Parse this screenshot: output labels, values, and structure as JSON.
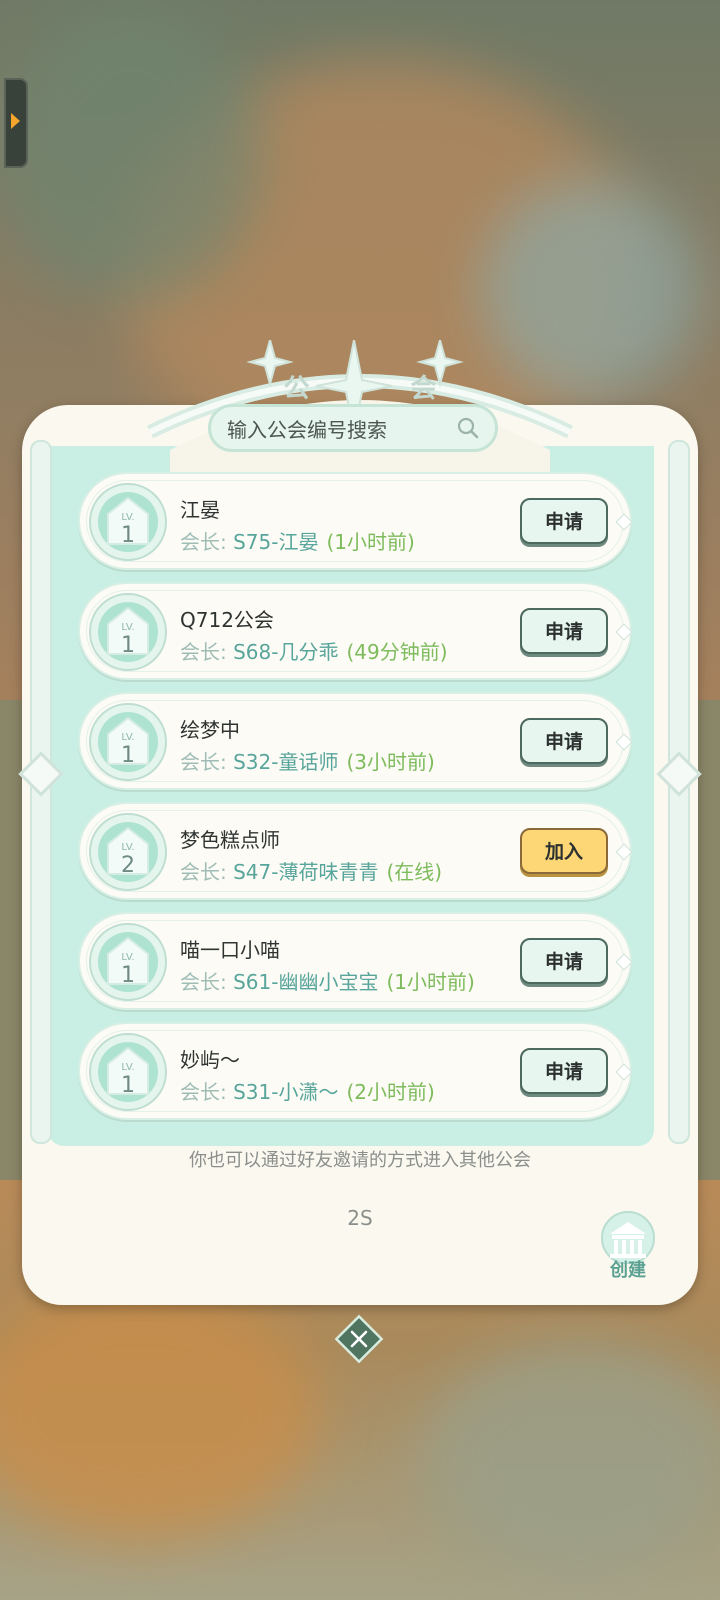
{
  "panel": {
    "title": "公 会",
    "search": {
      "placeholder": "输入公会编号搜索"
    }
  },
  "leader_label": "会长:",
  "guilds": [
    {
      "level": "1",
      "name": "江晏",
      "leader": "S75-江晏",
      "time": "(1小时前)",
      "action": "申请"
    },
    {
      "level": "1",
      "name": "Q712公会",
      "leader": "S68-几分乖",
      "time": "(49分钟前)",
      "action": "申请"
    },
    {
      "level": "1",
      "name": "绘梦中",
      "leader": "S32-童话师",
      "time": "(3小时前)",
      "action": "申请"
    },
    {
      "level": "2",
      "name": "梦色糕点师",
      "leader": "S47-薄荷味青青",
      "time": "(在线)",
      "action": "加入"
    },
    {
      "level": "1",
      "name": "喵一口小喵",
      "leader": "S61-幽幽小宝宝",
      "time": "(1小时前)",
      "action": "申请"
    },
    {
      "level": "1",
      "name": "妙屿～",
      "leader": "S31-小潇～",
      "time": "(2小时前)",
      "action": "申请"
    }
  ],
  "badge_text": "LV.",
  "hint": "你也可以通过好友邀请的方式进入其他公会",
  "server": "2S",
  "create_label": "创建",
  "colors": {
    "accent": "#c9efe4",
    "join_button": "#fdd676",
    "leader_name": "#58a59b",
    "time": "#7dbb5c"
  },
  "icons": {
    "search": "search-icon",
    "close": "close-icon",
    "create": "guild-hall-icon",
    "expand": "chevron-right-icon"
  }
}
